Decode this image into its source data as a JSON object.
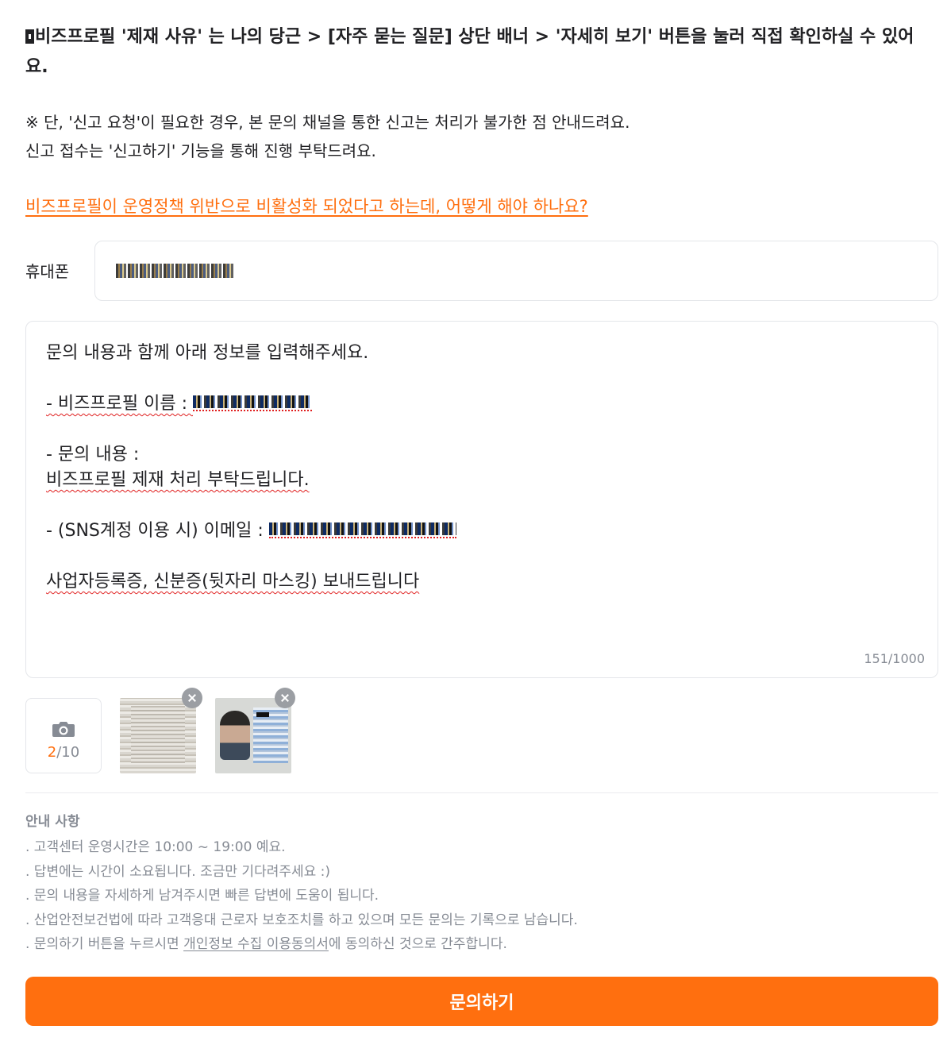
{
  "notice": {
    "bold_text": "비즈프로필 '제재 사유' 는 나의 당근 > [자주 묻는 질문] 상단 배너 > '자세히 보기' 버튼을 눌러 직접 확인하실 수 있어요.",
    "caution_line1": "※ 단, '신고 요청'이 필요한 경우, 본 문의 채널을 통한 신고는 처리가 불가한 점 안내드려요.",
    "caution_line2": "신고 접수는 '신고하기' 기능을 통해 진행 부탁드려요.",
    "faq_link": "비즈프로필이 운영정책 위반으로 비활성화 되었다고 하는데, 어떻게 해야 하나요?"
  },
  "phone": {
    "label": "휴대폰"
  },
  "content": {
    "intro": "문의 내용과 함께 아래 정보를 입력해주세요.",
    "biz_name_label": "- 비즈프로필 이름 : ",
    "inquiry_label": "- 문의 내용 :",
    "inquiry_body": "비즈프로필 제재 처리 부탁드립니다.",
    "email_label": "- (SNS계정 이용 시) 이메일 : ",
    "attach_note": "사업자등록증, 신분증(뒷자리 마스킹) 보내드립니다",
    "counter": "151/1000"
  },
  "photos": {
    "current": "2",
    "max": "/10",
    "icon": "camera-icon"
  },
  "guide": {
    "title": "안내 사항",
    "items": [
      ". 고객센터 운영시간은 10:00 ~ 19:00 예요.",
      ". 답변에는 시간이 소요됩니다. 조금만 기다려주세요 :)",
      ". 문의 내용을 자세하게 남겨주시면 빠른 답변에 도움이 됩니다.",
      ". 산업안전보건법에 따라 고객응대 근로자 보호조치를 하고 있으며 모든 문의는 기록으로 남습니다."
    ],
    "last_prefix": ". 문의하기 버튼을 누르시면 ",
    "last_link": "개인정보 수집 이용동의서",
    "last_suffix": "에 동의하신 것으로 간주합니다."
  },
  "submit": {
    "label": "문의하기"
  },
  "colors": {
    "accent": "#ff6f0f",
    "text": "#212124",
    "muted": "#868b94",
    "border": "#e4e6ea"
  }
}
